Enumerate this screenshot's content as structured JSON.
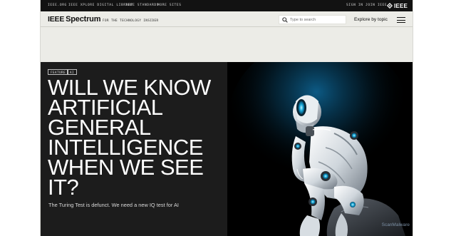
{
  "topbar": {
    "links": [
      "IEEE.ORG",
      "IEEE XPLORE DIGITAL LIBRARY",
      "IEEE STANDARDS",
      "MORE SITES"
    ],
    "right_links": [
      "SIGN IN",
      "JOIN IEEE"
    ],
    "logo_text": "IEEE"
  },
  "header": {
    "brand_ieee": "IEEE",
    "brand_spectrum": "Spectrum",
    "tagline": "FOR THE TECHNOLOGY INSIDER",
    "search_placeholder": "Type to search",
    "explore_label": "Explore by topic"
  },
  "hero": {
    "tags": [
      "FEATURE",
      "AI"
    ],
    "headline_lines": [
      "WILL WE KNOW",
      "ARTIFICIAL",
      "GENERAL",
      "INTELLIGENCE",
      "WHEN WE SEE",
      "IT?"
    ],
    "subtitle": "The Turing Test is defunct. We need a new IQ test for AI",
    "image_subject": "robot-thinker"
  },
  "overlay": {
    "watermark": "ScanMalware"
  },
  "colors": {
    "page_bg": "#ecece7",
    "topbar_bg": "#121212",
    "hero_left_bg": "#1c1c1c",
    "robot_accent": "#1aa7d6"
  }
}
